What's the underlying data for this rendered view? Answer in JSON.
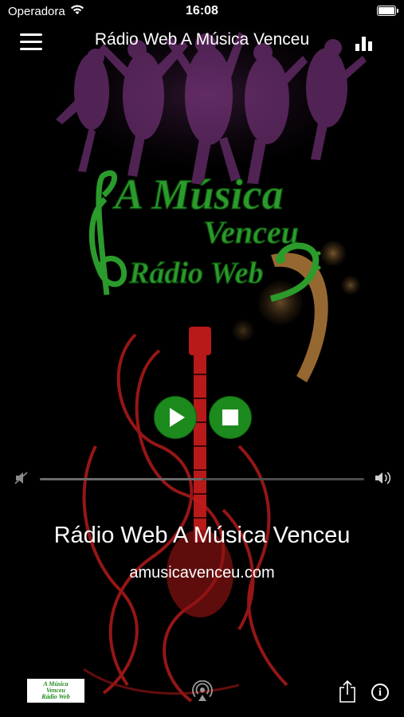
{
  "status_bar": {
    "carrier": "Operadora",
    "time": "16:08"
  },
  "nav": {
    "title": "Rádio Web A Música Venceu"
  },
  "logo": {
    "line1": "A Música",
    "line2": "Venceu",
    "line3": "Rádio Web",
    "color": "#2b9b2b"
  },
  "player": {
    "play_color": "#1d8a1d",
    "volume_level": 0.5
  },
  "station": {
    "name": "Rádio Web A Música Venceu",
    "url": "amusicavenceu.com"
  },
  "toolbar": {
    "thumb_line1": "A Música",
    "thumb_line2": "Venceu",
    "thumb_line3": "Rádio Web"
  },
  "icons": [
    "wifi-icon",
    "battery-icon",
    "menu-icon",
    "equalizer-icon",
    "play-icon",
    "stop-icon",
    "volume-low-icon",
    "volume-high-icon",
    "airplay-icon",
    "share-icon",
    "info-icon"
  ]
}
